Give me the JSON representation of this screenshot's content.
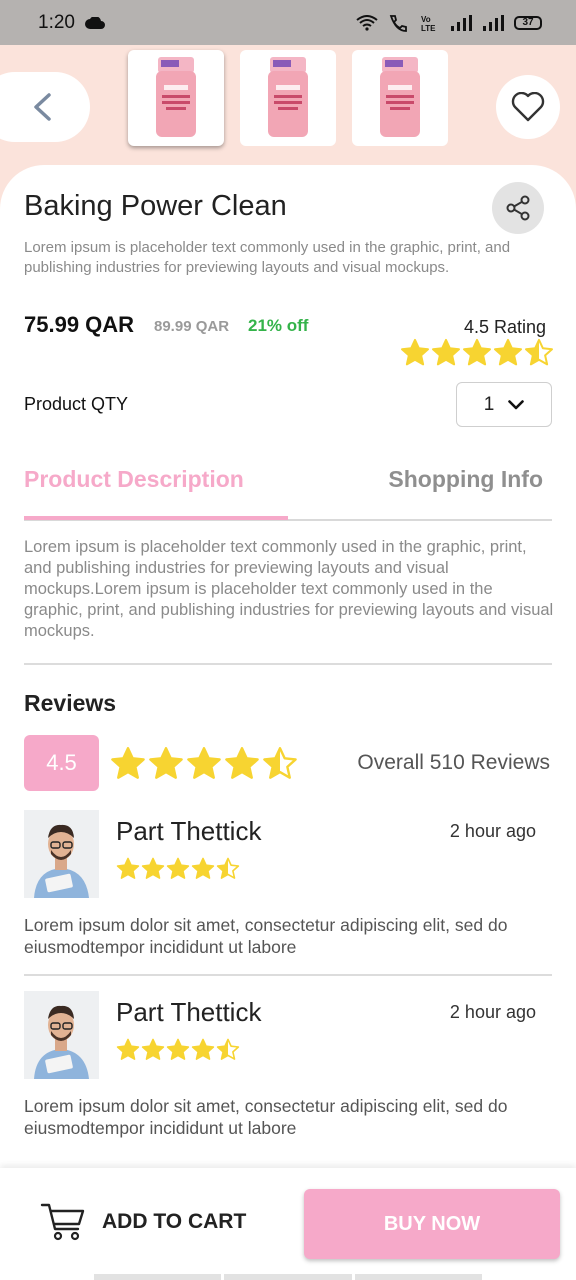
{
  "status_bar": {
    "time": "1:20",
    "battery": "37"
  },
  "product": {
    "title": "Baking Power Clean",
    "subtitle": "Lorem ipsum is placeholder text commonly used in the graphic, print, and publishing industries for previewing layouts and visual mockups.",
    "price": "75.99 QAR",
    "old_price": "89.99 QAR",
    "discount": "21% off",
    "rating_label": "4.5 Rating",
    "rating": 4.5,
    "qty_label": "Product QTY",
    "qty_value": "1",
    "images": [
      "product-bottle",
      "product-bottle",
      "product-bottle"
    ]
  },
  "tabs": {
    "description": "Product Description",
    "shipping": "Shopping Info"
  },
  "description": "Lorem ipsum is placeholder text commonly used in the graphic, print, and publishing industries for previewing layouts and visual mockups.Lorem ipsum is placeholder text commonly used in the graphic, print, and publishing industries for previewing layouts and visual mockups.",
  "reviews": {
    "title": "Reviews",
    "overall_score": "4.5",
    "overall_rating": 4.5,
    "overall_count": "Overall 510 Reviews",
    "items": [
      {
        "name": "Part Thettick",
        "time": "2 hour ago",
        "rating": 4.5,
        "text": "Lorem ipsum dolor sit amet, consectetur adipiscing elit, sed do eiusmodtempor incididunt ut labore"
      },
      {
        "name": "Part Thettick",
        "time": "2 hour ago",
        "rating": 4.5,
        "text": "Lorem ipsum dolor sit amet, consectetur adipiscing elit, sed do eiusmodtempor incididunt ut labore"
      }
    ]
  },
  "actions": {
    "add_to_cart": "ADD TO CART",
    "buy_now": "BUY NOW"
  },
  "colors": {
    "accent_pink": "#f6a9c9",
    "star_yellow": "#f7d431",
    "discount_green": "#34b34a",
    "header_bg": "#fbe3db"
  }
}
